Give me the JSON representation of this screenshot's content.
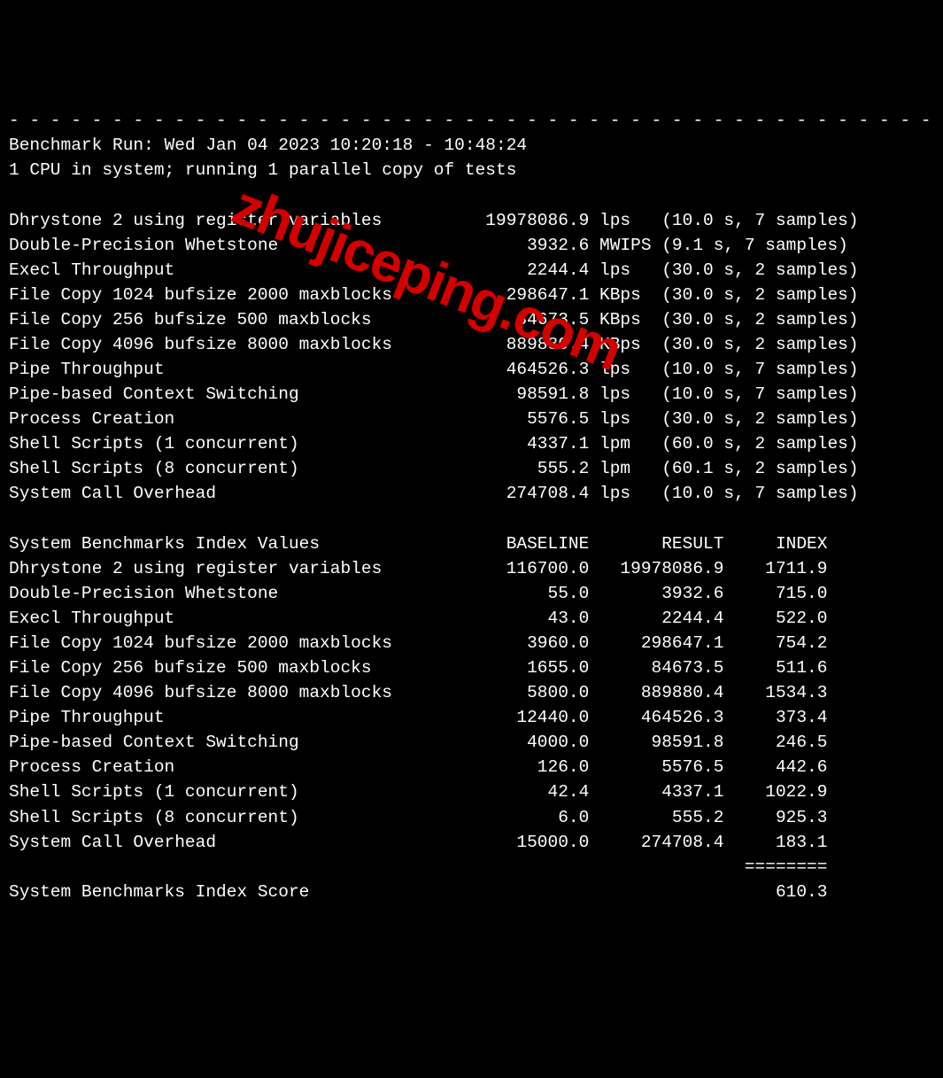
{
  "separator": "- - - - - - - - - - - - - - - - - - - - - - - - - - - - - - - - - - - - - - - - - - - - - - ",
  "header": {
    "run_line": "Benchmark Run: Wed Jan 04 2023 10:20:18 - 10:48:24",
    "cpu_line": "1 CPU in system; running 1 parallel copy of tests"
  },
  "results": [
    {
      "name": "Dhrystone 2 using register variables",
      "value": "19978086.9",
      "unit": "lps",
      "timing": "(10.0 s, 7 samples)"
    },
    {
      "name": "Double-Precision Whetstone",
      "value": "3932.6",
      "unit": "MWIPS",
      "timing": "(9.1 s, 7 samples)"
    },
    {
      "name": "Execl Throughput",
      "value": "2244.4",
      "unit": "lps",
      "timing": "(30.0 s, 2 samples)"
    },
    {
      "name": "File Copy 1024 bufsize 2000 maxblocks",
      "value": "298647.1",
      "unit": "KBps",
      "timing": "(30.0 s, 2 samples)"
    },
    {
      "name": "File Copy 256 bufsize 500 maxblocks",
      "value": "84673.5",
      "unit": "KBps",
      "timing": "(30.0 s, 2 samples)"
    },
    {
      "name": "File Copy 4096 bufsize 8000 maxblocks",
      "value": "889880.4",
      "unit": "KBps",
      "timing": "(30.0 s, 2 samples)"
    },
    {
      "name": "Pipe Throughput",
      "value": "464526.3",
      "unit": "lps",
      "timing": "(10.0 s, 7 samples)"
    },
    {
      "name": "Pipe-based Context Switching",
      "value": "98591.8",
      "unit": "lps",
      "timing": "(10.0 s, 7 samples)"
    },
    {
      "name": "Process Creation",
      "value": "5576.5",
      "unit": "lps",
      "timing": "(30.0 s, 2 samples)"
    },
    {
      "name": "Shell Scripts (1 concurrent)",
      "value": "4337.1",
      "unit": "lpm",
      "timing": "(60.0 s, 2 samples)"
    },
    {
      "name": "Shell Scripts (8 concurrent)",
      "value": "555.2",
      "unit": "lpm",
      "timing": "(60.1 s, 2 samples)"
    },
    {
      "name": "System Call Overhead",
      "value": "274708.4",
      "unit": "lps",
      "timing": "(10.0 s, 7 samples)"
    }
  ],
  "index_header": {
    "label": "System Benchmarks Index Values",
    "baseline": "BASELINE",
    "result": "RESULT",
    "index": "INDEX"
  },
  "index_rows": [
    {
      "name": "Dhrystone 2 using register variables",
      "baseline": "116700.0",
      "result": "19978086.9",
      "index": "1711.9"
    },
    {
      "name": "Double-Precision Whetstone",
      "baseline": "55.0",
      "result": "3932.6",
      "index": "715.0"
    },
    {
      "name": "Execl Throughput",
      "baseline": "43.0",
      "result": "2244.4",
      "index": "522.0"
    },
    {
      "name": "File Copy 1024 bufsize 2000 maxblocks",
      "baseline": "3960.0",
      "result": "298647.1",
      "index": "754.2"
    },
    {
      "name": "File Copy 256 bufsize 500 maxblocks",
      "baseline": "1655.0",
      "result": "84673.5",
      "index": "511.6"
    },
    {
      "name": "File Copy 4096 bufsize 8000 maxblocks",
      "baseline": "5800.0",
      "result": "889880.4",
      "index": "1534.3"
    },
    {
      "name": "Pipe Throughput",
      "baseline": "12440.0",
      "result": "464526.3",
      "index": "373.4"
    },
    {
      "name": "Pipe-based Context Switching",
      "baseline": "4000.0",
      "result": "98591.8",
      "index": "246.5"
    },
    {
      "name": "Process Creation",
      "baseline": "126.0",
      "result": "5576.5",
      "index": "442.6"
    },
    {
      "name": "Shell Scripts (1 concurrent)",
      "baseline": "42.4",
      "result": "4337.1",
      "index": "1022.9"
    },
    {
      "name": "Shell Scripts (8 concurrent)",
      "baseline": "6.0",
      "result": "555.2",
      "index": "925.3"
    },
    {
      "name": "System Call Overhead",
      "baseline": "15000.0",
      "result": "274708.4",
      "index": "183.1"
    }
  ],
  "index_separator": "                                                                       ========",
  "score": {
    "label": "System Benchmarks Index Score",
    "value": "610.3"
  },
  "watermark": "zhujiceping.com"
}
